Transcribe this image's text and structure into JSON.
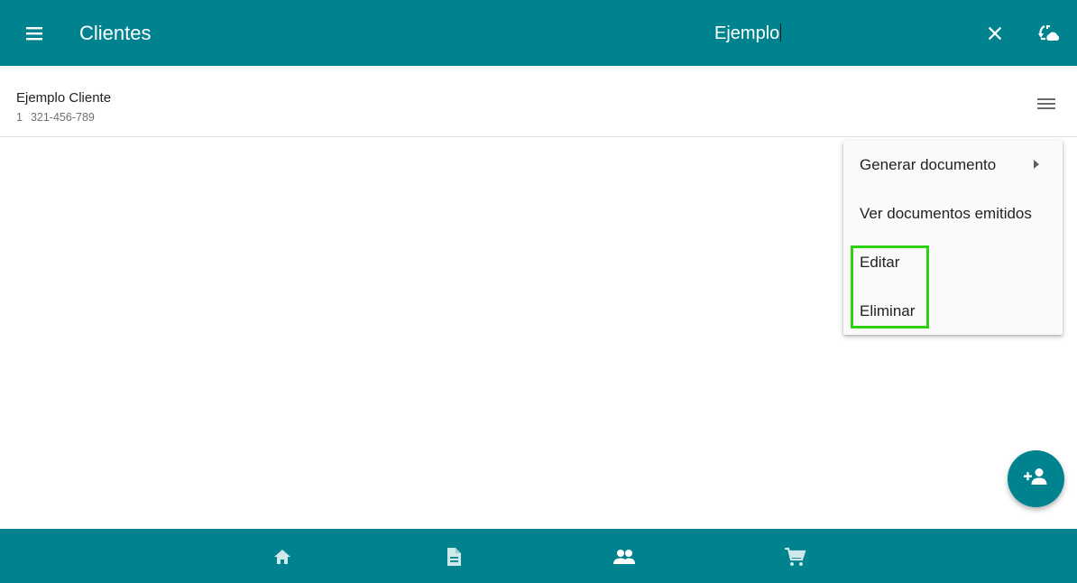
{
  "header": {
    "title": "Clientes",
    "search_value": "Ejemplo",
    "menu_icon": "hamburger-menu-icon",
    "clear_icon": "close-icon",
    "sync_icon": "cloud-sync-icon"
  },
  "client_list": [
    {
      "name": "Ejemplo Cliente",
      "number": "1",
      "phone": "321-456-789"
    }
  ],
  "row_menu_icon": "row-menu-icon",
  "popup_menu": {
    "items": [
      {
        "label": "Generar documento",
        "has_submenu": true
      },
      {
        "label": "Ver documentos emitidos",
        "has_submenu": false
      },
      {
        "label": "Editar",
        "has_submenu": false
      },
      {
        "label": "Eliminar",
        "has_submenu": false
      }
    ]
  },
  "fab_icon": "add-person-icon",
  "bottom_nav": {
    "items": [
      "home-icon",
      "document-icon",
      "people-icon",
      "cart-icon"
    ]
  },
  "colors": {
    "primary": "#00838f",
    "highlight": "#2fd10f"
  }
}
